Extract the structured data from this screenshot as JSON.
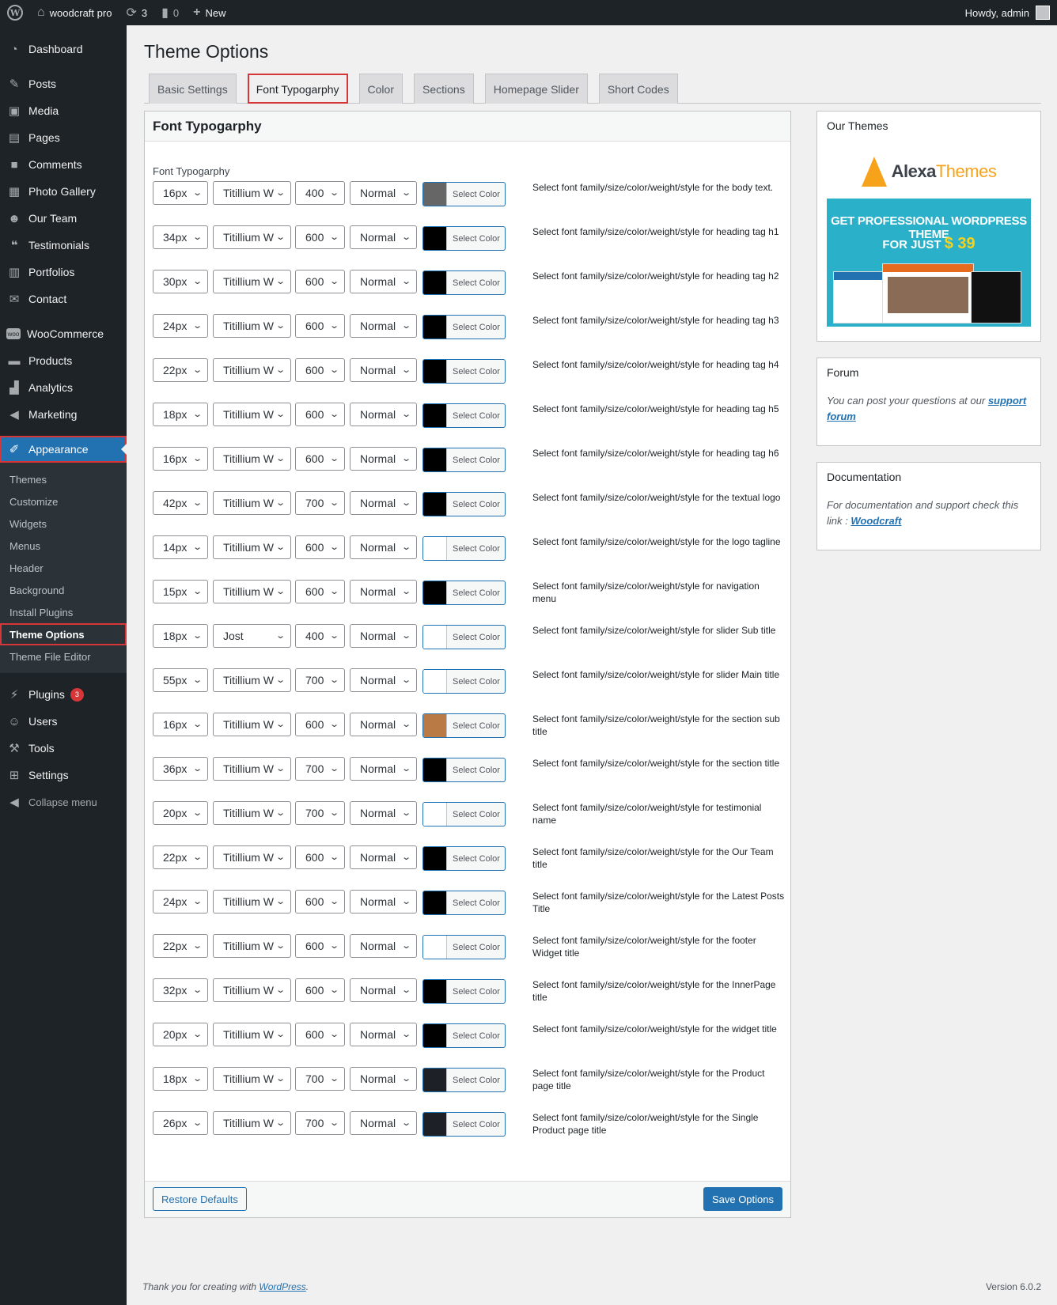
{
  "adminbar": {
    "site_name": "woodcraft pro",
    "updates_count": "3",
    "comments_count": "0",
    "new_label": "New",
    "howdy": "Howdy, admin"
  },
  "sidebar": {
    "items": [
      {
        "label": "Dashboard",
        "icon": "dashboard-icon"
      },
      {
        "label": "Posts",
        "icon": "pushpin-icon"
      },
      {
        "label": "Media",
        "icon": "media-icon"
      },
      {
        "label": "Pages",
        "icon": "pages-icon"
      },
      {
        "label": "Comments",
        "icon": "comment-icon"
      },
      {
        "label": "Photo Gallery",
        "icon": "gallery-icon"
      },
      {
        "label": "Our Team",
        "icon": "team-icon"
      },
      {
        "label": "Testimonials",
        "icon": "quote-icon"
      },
      {
        "label": "Portfolios",
        "icon": "portfolio-icon"
      },
      {
        "label": "Contact",
        "icon": "mail-icon"
      },
      {
        "label": "WooCommerce",
        "icon": "woo-icon"
      },
      {
        "label": "Products",
        "icon": "archive-icon"
      },
      {
        "label": "Analytics",
        "icon": "bar-chart-icon"
      },
      {
        "label": "Marketing",
        "icon": "megaphone-icon"
      },
      {
        "label": "Appearance",
        "icon": "brush-icon"
      },
      {
        "label": "Plugins",
        "icon": "plug-icon",
        "badge": "3"
      },
      {
        "label": "Users",
        "icon": "user-icon"
      },
      {
        "label": "Tools",
        "icon": "wrench-icon"
      },
      {
        "label": "Settings",
        "icon": "settings-icon"
      },
      {
        "label": "Collapse menu",
        "icon": "collapse-icon"
      }
    ],
    "submenu": [
      "Themes",
      "Customize",
      "Widgets",
      "Menus",
      "Header",
      "Background",
      "Install Plugins",
      "Theme Options",
      "Theme File Editor"
    ]
  },
  "page": {
    "title": "Theme Options",
    "tabs": [
      "Basic Settings",
      "Font Typogarphy",
      "Color",
      "Sections",
      "Homepage Slider",
      "Short Codes"
    ],
    "active_tab": "Font Typogarphy"
  },
  "panel": {
    "title": "Font Typogarphy",
    "section_label": "Font Typogarphy",
    "color_button_label": "Select Color",
    "rows": [
      {
        "size": "16px",
        "font": "Titillium W",
        "weight": "400",
        "style": "Normal",
        "color": "#666666",
        "desc": "Select font family/size/color/weight/style for the body text."
      },
      {
        "size": "34px",
        "font": "Titillium W",
        "weight": "600",
        "style": "Normal",
        "color": "#000000",
        "desc": "Select font family/size/color/weight/style for heading tag h1"
      },
      {
        "size": "30px",
        "font": "Titillium W",
        "weight": "600",
        "style": "Normal",
        "color": "#000000",
        "desc": "Select font family/size/color/weight/style for heading tag h2"
      },
      {
        "size": "24px",
        "font": "Titillium W",
        "weight": "600",
        "style": "Normal",
        "color": "#000000",
        "desc": "Select font family/size/color/weight/style for heading tag h3"
      },
      {
        "size": "22px",
        "font": "Titillium W",
        "weight": "600",
        "style": "Normal",
        "color": "#000000",
        "desc": "Select font family/size/color/weight/style for heading tag h4"
      },
      {
        "size": "18px",
        "font": "Titillium W",
        "weight": "600",
        "style": "Normal",
        "color": "#000000",
        "desc": "Select font family/size/color/weight/style for heading tag h5"
      },
      {
        "size": "16px",
        "font": "Titillium W",
        "weight": "600",
        "style": "Normal",
        "color": "#000000",
        "desc": "Select font family/size/color/weight/style for heading tag h6"
      },
      {
        "size": "42px",
        "font": "Titillium W",
        "weight": "700",
        "style": "Normal",
        "color": "#000000",
        "desc": "Select font family/size/color/weight/style for the textual logo"
      },
      {
        "size": "14px",
        "font": "Titillium W",
        "weight": "600",
        "style": "Normal",
        "color": "#ffffff",
        "desc": "Select font family/size/color/weight/style for the logo tagline"
      },
      {
        "size": "15px",
        "font": "Titillium W",
        "weight": "600",
        "style": "Normal",
        "color": "#000000",
        "desc": "Select font family/size/color/weight/style for navigation menu"
      },
      {
        "size": "18px",
        "font": "Jost",
        "weight": "400",
        "style": "Normal",
        "color": "#ffffff",
        "desc": "Select font family/size/color/weight/style for slider Sub title"
      },
      {
        "size": "55px",
        "font": "Titillium W",
        "weight": "700",
        "style": "Normal",
        "color": "#ffffff",
        "desc": "Select font family/size/color/weight/style for slider Main title"
      },
      {
        "size": "16px",
        "font": "Titillium W",
        "weight": "600",
        "style": "Normal",
        "color": "#b97a45",
        "desc": "Select font family/size/color/weight/style for the section sub title"
      },
      {
        "size": "36px",
        "font": "Titillium W",
        "weight": "700",
        "style": "Normal",
        "color": "#000000",
        "desc": "Select font family/size/color/weight/style for the section title"
      },
      {
        "size": "20px",
        "font": "Titillium W",
        "weight": "700",
        "style": "Normal",
        "color": "#ffffff",
        "desc": "Select font family/size/color/weight/style for testimonial name"
      },
      {
        "size": "22px",
        "font": "Titillium W",
        "weight": "600",
        "style": "Normal",
        "color": "#000000",
        "desc": "Select font family/size/color/weight/style for the Our Team title"
      },
      {
        "size": "24px",
        "font": "Titillium W",
        "weight": "600",
        "style": "Normal",
        "color": "#000000",
        "desc": "Select font family/size/color/weight/style for the Latest Posts Title"
      },
      {
        "size": "22px",
        "font": "Titillium W",
        "weight": "600",
        "style": "Normal",
        "color": "#ffffff",
        "desc": "Select font family/size/color/weight/style for the footer Widget title"
      },
      {
        "size": "32px",
        "font": "Titillium W",
        "weight": "600",
        "style": "Normal",
        "color": "#000000",
        "desc": "Select font family/size/color/weight/style for the InnerPage title"
      },
      {
        "size": "20px",
        "font": "Titillium W",
        "weight": "600",
        "style": "Normal",
        "color": "#000000",
        "desc": "Select font family/size/color/weight/style for the widget title"
      },
      {
        "size": "18px",
        "font": "Titillium W",
        "weight": "700",
        "style": "Normal",
        "color": "#1d2027",
        "desc": "Select font family/size/color/weight/style for the Product page title"
      },
      {
        "size": "26px",
        "font": "Titillium W",
        "weight": "700",
        "style": "Normal",
        "color": "#1d2027",
        "desc": "Select font family/size/color/weight/style for the Single Product page title"
      }
    ],
    "restore_label": "Restore Defaults",
    "save_label": "Save Options"
  },
  "our_themes": {
    "title": "Our Themes",
    "brand_a": "Alexa",
    "brand_b": "Themes",
    "banner_line1": "GET PROFESSIONAL WORDPRESS THEME",
    "banner_line2": "FOR JUST",
    "banner_price": "$ 39"
  },
  "forum": {
    "title": "Forum",
    "text": "You can post your questions at our",
    "link": "support forum"
  },
  "documentation": {
    "title": "Documentation",
    "text": "For documentation and support check this link :",
    "link": "Woodcraft"
  },
  "footer": {
    "thanks": "Thank you for creating with",
    "link": "WordPress",
    "period": ".",
    "version": "Version 6.0.2"
  }
}
